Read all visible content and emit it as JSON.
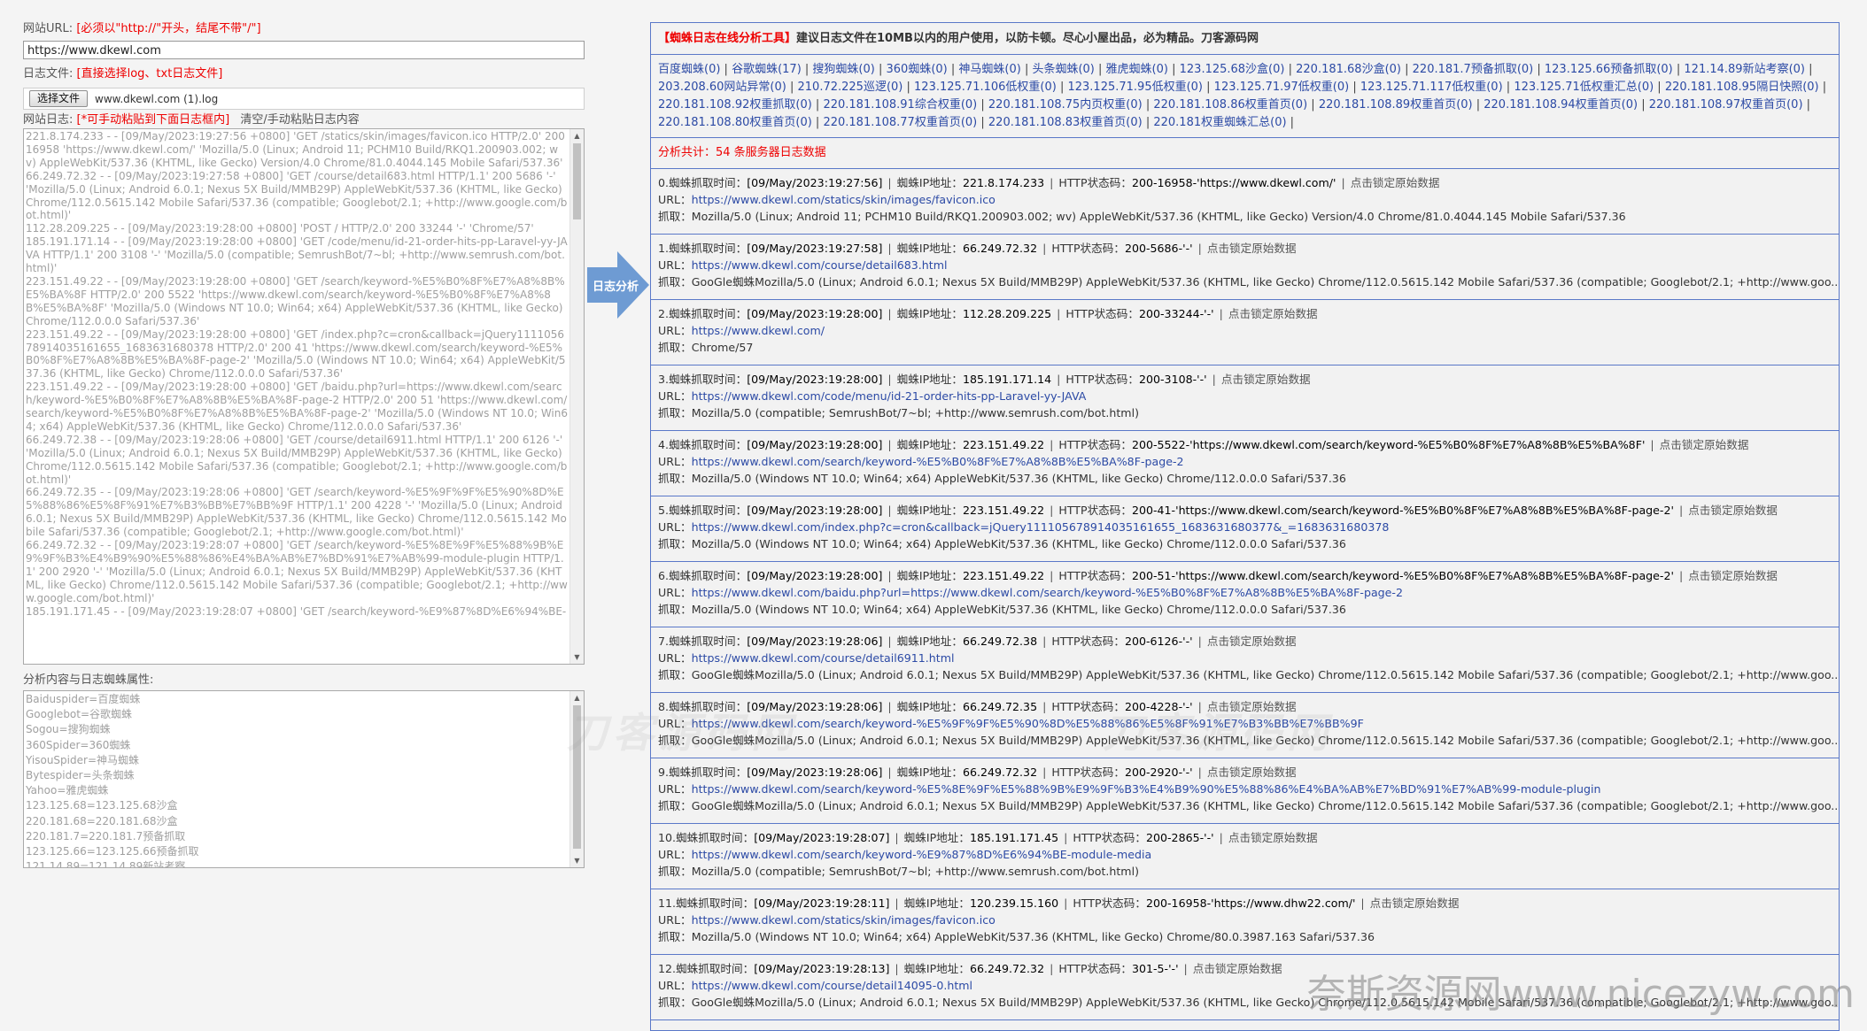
{
  "left": {
    "url_label": "网站URL:",
    "url_hint": "[必须以\"http://\"开头，结尾不带\"/\"]",
    "url_value": "https://www.dkewl.com",
    "file_label": "日志文件:",
    "file_hint": "[直接选择log、txt日志文件]",
    "file_button": "选择文件",
    "file_name": "www.dkewl.com (1).log",
    "log_label": "网站日志:",
    "log_hint": "[*可手动粘贴到下面日志框内]",
    "log_clear": "清空/手动粘贴日志内容",
    "log_text": "221.8.174.233 - - [09/May/2023:19:27:56 +0800] 'GET /statics/skin/images/favicon.ico HTTP/2.0' 200 16958 'https://www.dkewl.com/' 'Mozilla/5.0 (Linux; Android 11; PCHM10 Build/RKQ1.200903.002; wv) AppleWebKit/537.36 (KHTML, like Gecko) Version/4.0 Chrome/81.0.4044.145 Mobile Safari/537.36'\n66.249.72.32 - - [09/May/2023:19:27:58 +0800] 'GET /course/detail683.html HTTP/1.1' 200 5686 '-' 'Mozilla/5.0 (Linux; Android 6.0.1; Nexus 5X Build/MMB29P) AppleWebKit/537.36 (KHTML, like Gecko) Chrome/112.0.5615.142 Mobile Safari/537.36 (compatible; Googlebot/2.1; +http://www.google.com/bot.html)'\n112.28.209.225 - - [09/May/2023:19:28:00 +0800] 'POST / HTTP/2.0' 200 33244 '-' 'Chrome/57'\n185.191.171.14 - - [09/May/2023:19:28:00 +0800] 'GET /code/menu/id-21-order-hits-pp-Laravel-yy-JAVA HTTP/1.1' 200 3108 '-' 'Mozilla/5.0 (compatible; SemrushBot/7~bl; +http://www.semrush.com/bot.html)'\n223.151.49.22 - - [09/May/2023:19:28:00 +0800] 'GET /search/keyword-%E5%B0%8F%E7%A8%8B%E5%BA%8F HTTP/2.0' 200 5522 'https://www.dkewl.com/search/keyword-%E5%B0%8F%E7%A8%8B%E5%BA%8F' 'Mozilla/5.0 (Windows NT 10.0; Win64; x64) AppleWebKit/537.36 (KHTML, like Gecko) Chrome/112.0.0.0 Safari/537.36'\n223.151.49.22 - - [09/May/2023:19:28:00 +0800] 'GET /index.php?c=cron&callback=jQuery111105678914035161655_1683631680378 HTTP/2.0' 200 41 'https://www.dkewl.com/search/keyword-%E5%B0%8F%E7%A8%8B%E5%BA%8F-page-2' 'Mozilla/5.0 (Windows NT 10.0; Win64; x64) AppleWebKit/537.36 (KHTML, like Gecko) Chrome/112.0.0.0 Safari/537.36'\n223.151.49.22 - - [09/May/2023:19:28:00 +0800] 'GET /baidu.php?url=https://www.dkewl.com/search/keyword-%E5%B0%8F%E7%A8%8B%E5%BA%8F-page-2 HTTP/2.0' 200 51 'https://www.dkewl.com/search/keyword-%E5%B0%8F%E7%A8%8B%E5%BA%8F-page-2' 'Mozilla/5.0 (Windows NT 10.0; Win64; x64) AppleWebKit/537.36 (KHTML, like Gecko) Chrome/112.0.0.0 Safari/537.36'\n66.249.72.38 - - [09/May/2023:19:28:06 +0800] 'GET /course/detail6911.html HTTP/1.1' 200 6126 '-' 'Mozilla/5.0 (Linux; Android 6.0.1; Nexus 5X Build/MMB29P) AppleWebKit/537.36 (KHTML, like Gecko) Chrome/112.0.5615.142 Mobile Safari/537.36 (compatible; Googlebot/2.1; +http://www.google.com/bot.html)'\n66.249.72.35 - - [09/May/2023:19:28:06 +0800] 'GET /search/keyword-%E5%9F%9F%E5%90%8D%E5%88%86%E5%8F%91%E7%B3%BB%E7%BB%9F HTTP/1.1' 200 4228 '-' 'Mozilla/5.0 (Linux; Android 6.0.1; Nexus 5X Build/MMB29P) AppleWebKit/537.36 (KHTML, like Gecko) Chrome/112.0.5615.142 Mobile Safari/537.36 (compatible; Googlebot/2.1; +http://www.google.com/bot.html)'\n66.249.72.32 - - [09/May/2023:19:28:07 +0800] 'GET /search/keyword-%E5%8E%9F%E5%88%9B%E9%9F%B3%E4%B9%90%E5%88%86%E4%BA%AB%E7%BD%91%E7%AB%99-module-plugin HTTP/1.1' 200 2920 '-' 'Mozilla/5.0 (Linux; Android 6.0.1; Nexus 5X Build/MMB29P) AppleWebKit/537.36 (KHTML, like Gecko) Chrome/112.0.5615.142 Mobile Safari/537.36 (compatible; Googlebot/2.1; +http://www.google.com/bot.html)'\n185.191.171.45 - - [09/May/2023:19:28:07 +0800] 'GET /search/keyword-%E9%87%8D%E6%94%BE-",
    "attr_label": "分析内容与日志蜘蛛属性:",
    "attr_text": "Baiduspider=百度蜘蛛\nGooglebot=谷歌蜘蛛\nSogou=搜狗蜘蛛\n360Spider=360蜘蛛\nYisouSpider=神马蜘蛛\nBytespider=头条蜘蛛\nYahoo=雅虎蜘蛛\n123.125.68=123.125.68沙盒\n220.181.68=220.181.68沙盒\n220.181.7=220.181.7预备抓取\n123.125.66=123.125.66预备抓取\n121.14.89=121.14.89新站考察"
  },
  "arrow_label": "日志分析",
  "right": {
    "title_brand": "【蜘蛛日志在线分析工具】",
    "title_rest": "建议日志文件在10MB以内的用户使用，以防卡顿。尽心小屋出品，必为精品。刀客源码网",
    "spiders": [
      "百度蜘蛛(0)",
      "谷歌蜘蛛(17)",
      "搜狗蜘蛛(0)",
      "360蜘蛛(0)",
      "神马蜘蛛(0)",
      "头条蜘蛛(0)",
      "雅虎蜘蛛(0)",
      "123.125.68沙盒(0)",
      "220.181.68沙盒(0)",
      "220.181.7预备抓取(0)",
      "123.125.66预备抓取(0)",
      "121.14.89新站考察(0)",
      "203.208.60网站异常(0)",
      "210.72.225巡逻(0)",
      "123.125.71.106低权重(0)",
      "123.125.71.95低权重(0)",
      "123.125.71.97低权重(0)",
      "123.125.71.117低权重(0)",
      "123.125.71低权重汇总(0)",
      "220.181.108.95隔日快照(0)",
      "220.181.108.92权重抓取(0)",
      "220.181.108.91综合权重(0)",
      "220.181.108.75内页权重(0)",
      "220.181.108.86权重首页(0)",
      "220.181.108.89权重首页(0)",
      "220.181.108.94权重首页(0)",
      "220.181.108.97权重首页(0)",
      "220.181.108.80权重首页(0)",
      "220.181.108.77权重首页(0)",
      "220.181.108.83权重首页(0)",
      "220.181权重蜘蛛汇总(0)"
    ],
    "count_text": "分析共计：54 条服务器日志数据",
    "entries": [
      {
        "idx": "0.",
        "time": "[09/May/2023:19:27:56]",
        "ip": "221.8.174.233",
        "status": "200-16958-'https://www.dkewl.com/'",
        "url": "https://www.dkewl.com/statics/skin/images/favicon.ico",
        "ua": "Mozilla/5.0 (Linux; Android 11; PCHM10 Build/RKQ1.200903.002; wv) AppleWebKit/537.36 (KHTML, like Gecko) Version/4.0 Chrome/81.0.4044.145 Mobile Safari/537.36"
      },
      {
        "idx": "1.",
        "time": "[09/May/2023:19:27:58]",
        "ip": "66.249.72.32",
        "status": "200-5686-'-'",
        "url": "https://www.dkewl.com/course/detail683.html",
        "ua": "GooGle蜘蛛Mozilla/5.0 (Linux; Android 6.0.1; Nexus 5X Build/MMB29P) AppleWebKit/537.36 (KHTML, like Gecko) Chrome/112.0.5615.142 Mobile Safari/537.36 (compatible; Googlebot/2.1; +http://www.goo..."
      },
      {
        "idx": "2.",
        "time": "[09/May/2023:19:28:00]",
        "ip": "112.28.209.225",
        "status": "200-33244-'-'",
        "url": "https://www.dkewl.com/",
        "ua": "Chrome/57"
      },
      {
        "idx": "3.",
        "time": "[09/May/2023:19:28:00]",
        "ip": "185.191.171.14",
        "status": "200-3108-'-'",
        "url": "https://www.dkewl.com/code/menu/id-21-order-hits-pp-Laravel-yy-JAVA",
        "ua": "Mozilla/5.0 (compatible; SemrushBot/7~bl; +http://www.semrush.com/bot.html)"
      },
      {
        "idx": "4.",
        "time": "[09/May/2023:19:28:00]",
        "ip": "223.151.49.22",
        "status": "200-5522-'https://www.dkewl.com/search/keyword-%E5%B0%8F%E7%A8%8B%E5%BA%8F'",
        "url": "https://www.dkewl.com/search/keyword-%E5%B0%8F%E7%A8%8B%E5%BA%8F-page-2",
        "ua": "Mozilla/5.0 (Windows NT 10.0; Win64; x64) AppleWebKit/537.36 (KHTML, like Gecko) Chrome/112.0.0.0 Safari/537.36"
      },
      {
        "idx": "5.",
        "time": "[09/May/2023:19:28:00]",
        "ip": "223.151.49.22",
        "status": "200-41-'https://www.dkewl.com/search/keyword-%E5%B0%8F%E7%A8%8B%E5%BA%8F-page-2'",
        "url": "https://www.dkewl.com/index.php?c=cron&callback=jQuery111105678914035161655_1683631680377&_=1683631680378",
        "ua": "Mozilla/5.0 (Windows NT 10.0; Win64; x64) AppleWebKit/537.36 (KHTML, like Gecko) Chrome/112.0.0.0 Safari/537.36"
      },
      {
        "idx": "6.",
        "time": "[09/May/2023:19:28:00]",
        "ip": "223.151.49.22",
        "status": "200-51-'https://www.dkewl.com/search/keyword-%E5%B0%8F%E7%A8%8B%E5%BA%8F-page-2'",
        "url": "https://www.dkewl.com/baidu.php?url=https://www.dkewl.com/search/keyword-%E5%B0%8F%E7%A8%8B%E5%BA%8F-page-2",
        "ua": "Mozilla/5.0 (Windows NT 10.0; Win64; x64) AppleWebKit/537.36 (KHTML, like Gecko) Chrome/112.0.0.0 Safari/537.36"
      },
      {
        "idx": "7.",
        "time": "[09/May/2023:19:28:06]",
        "ip": "66.249.72.38",
        "status": "200-6126-'-'",
        "url": "https://www.dkewl.com/course/detail6911.html",
        "ua": "GooGle蜘蛛Mozilla/5.0 (Linux; Android 6.0.1; Nexus 5X Build/MMB29P) AppleWebKit/537.36 (KHTML, like Gecko) Chrome/112.0.5615.142 Mobile Safari/537.36 (compatible; Googlebot/2.1; +http://www.goo..."
      },
      {
        "idx": "8.",
        "time": "[09/May/2023:19:28:06]",
        "ip": "66.249.72.35",
        "status": "200-4228-'-'",
        "url": "https://www.dkewl.com/search/keyword-%E5%9F%9F%E5%90%8D%E5%88%86%E5%8F%91%E7%B3%BB%E7%BB%9F",
        "ua": "GooGle蜘蛛Mozilla/5.0 (Linux; Android 6.0.1; Nexus 5X Build/MMB29P) AppleWebKit/537.36 (KHTML, like Gecko) Chrome/112.0.5615.142 Mobile Safari/537.36 (compatible; Googlebot/2.1; +http://www.goo..."
      },
      {
        "idx": "9.",
        "time": "[09/May/2023:19:28:06]",
        "ip": "66.249.72.32",
        "status": "200-2920-'-'",
        "url": "https://www.dkewl.com/search/keyword-%E5%8E%9F%E5%88%9B%E9%9F%B3%E4%B9%90%E5%88%86%E4%BA%AB%E7%BD%91%E7%AB%99-module-plugin",
        "ua": "GooGle蜘蛛Mozilla/5.0 (Linux; Android 6.0.1; Nexus 5X Build/MMB29P) AppleWebKit/537.36 (KHTML, like Gecko) Chrome/112.0.5615.142 Mobile Safari/537.36 (compatible; Googlebot/2.1; +http://www.goo..."
      },
      {
        "idx": "10.",
        "time": "[09/May/2023:19:28:07]",
        "ip": "185.191.171.45",
        "status": "200-2865-'-'",
        "url": "https://www.dkewl.com/search/keyword-%E9%87%8D%E6%94%BE-module-media",
        "ua": "Mozilla/5.0 (compatible; SemrushBot/7~bl; +http://www.semrush.com/bot.html)"
      },
      {
        "idx": "11.",
        "time": "[09/May/2023:19:28:11]",
        "ip": "120.239.15.160",
        "status": "200-16958-'https://www.dhw22.com/'",
        "url": "https://www.dkewl.com/statics/skin/images/favicon.ico",
        "ua": "Mozilla/5.0 (Windows NT 10.0; Win64; x64) AppleWebKit/537.36 (KHTML, like Gecko) Chrome/80.0.3987.163 Safari/537.36"
      },
      {
        "idx": "12.",
        "time": "[09/May/2023:19:28:13]",
        "ip": "66.249.72.32",
        "status": "301-5-'-'",
        "url": "https://www.dkewl.com/course/detail14095-0.html",
        "ua": "GooGle蜘蛛Mozilla/5.0 (Linux; Android 6.0.1; Nexus 5X Build/MMB29P) AppleWebKit/537.36 (KHTML, like Gecko) Chrome/112.0.5615.142 Mobile Safari/537.36 (compatible; Googlebot/2.1; +http://www.goo..."
      }
    ],
    "labels": {
      "time": "蜘蛛抓取时间：",
      "ip": "蜘蛛IP地址：",
      "status": "HTTP状态码：",
      "lock": "点击锁定原始数据",
      "url": "URL：",
      "ua": "抓取："
    }
  },
  "watermark_logo": "刀客源码网",
  "watermark_site": "奈斯资源网www.nicezyw.com"
}
